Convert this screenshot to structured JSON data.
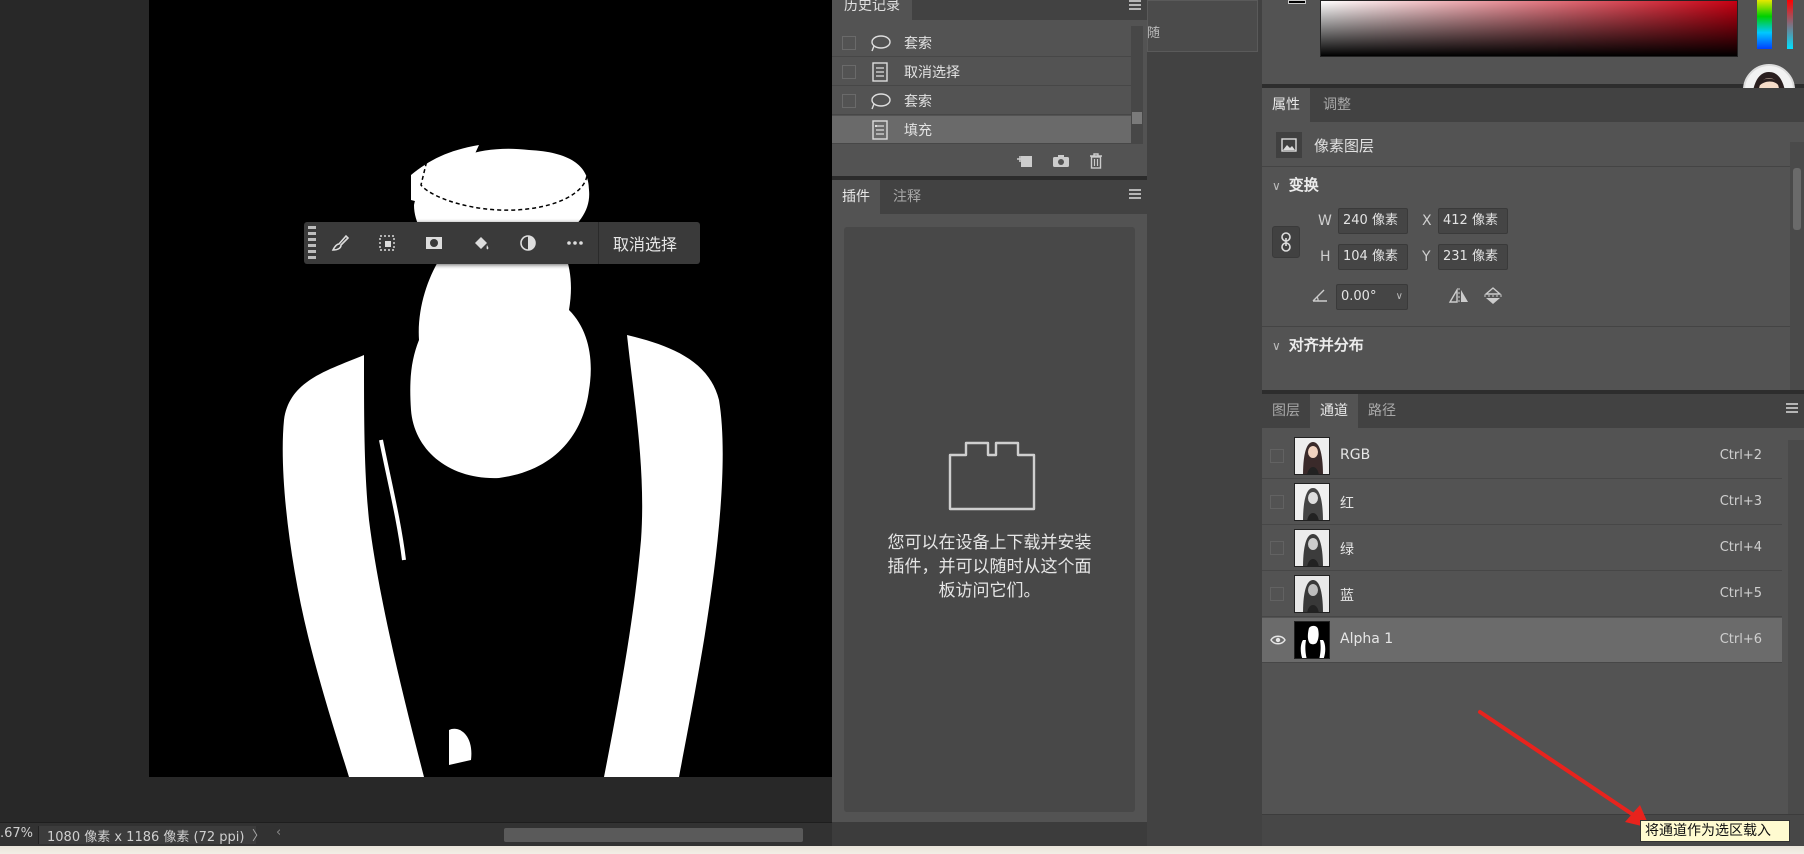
{
  "context_bar": {
    "tools": [
      "brush-icon",
      "select-subject-icon",
      "mask-icon",
      "fill-icon",
      "adjustment-icon",
      "more-icon"
    ],
    "deselect_label": "取消选择"
  },
  "status_bar": {
    "zoom": ".67%",
    "doc_info": "1080 像素 x 1186 像素 (72 ppi)",
    "arrow": "〉",
    "scroll_left": "‹"
  },
  "history": {
    "tab_label": "历史记录",
    "items": [
      {
        "label": "套索",
        "icon": "lasso-icon"
      },
      {
        "label": "取消选择",
        "icon": "document-icon"
      },
      {
        "label": "套索",
        "icon": "lasso-icon"
      },
      {
        "label": "填充",
        "icon": "fill-list-icon"
      }
    ],
    "footer_buttons": [
      "new-document-from-state-icon",
      "camera-snapshot-icon",
      "trash-icon"
    ]
  },
  "plugins": {
    "tabs": [
      "插件",
      "注释"
    ],
    "message": "您可以在设备上下载并安装插件，并可以随时从这个面板访问它们。"
  },
  "divider": {
    "char": "随"
  },
  "properties": {
    "tabs": [
      "属性",
      "调整"
    ],
    "layer_type": "像素图层",
    "transform_title": "变换",
    "w_label": "W",
    "w_value": "240 像素",
    "x_label": "X",
    "x_value": "412 像素",
    "h_label": "H",
    "h_value": "104 像素",
    "y_label": "Y",
    "y_value": "231 像素",
    "angle_value": "0.00°",
    "align_title": "对齐并分布"
  },
  "channels": {
    "tabs": [
      "图层",
      "通道",
      "路径"
    ],
    "rows": [
      {
        "name": "RGB",
        "shortcut": "Ctrl+2",
        "visible": false,
        "selected": false
      },
      {
        "name": "红",
        "shortcut": "Ctrl+3",
        "visible": false,
        "selected": false
      },
      {
        "name": "绿",
        "shortcut": "Ctrl+4",
        "visible": false,
        "selected": false
      },
      {
        "name": "蓝",
        "shortcut": "Ctrl+5",
        "visible": false,
        "selected": false
      },
      {
        "name": "Alpha 1",
        "shortcut": "Ctrl+6",
        "visible": true,
        "selected": true
      }
    ]
  },
  "tooltip": {
    "text": "将通道作为选区载入"
  },
  "colors": {
    "accent_arrow": "#e8231d",
    "panel": "#535353",
    "tooltip_bg": "#fffbd0"
  }
}
